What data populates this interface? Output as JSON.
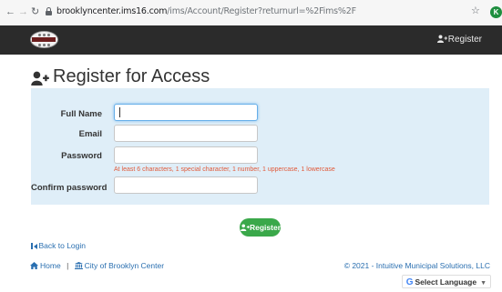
{
  "browser": {
    "url_host": "brooklyncenter.ims16.com",
    "url_path": "/ims/Account/Register?returnurl=%2Fims%2F",
    "avatar_initial": "K"
  },
  "navbar": {
    "logo_text": "CENTER",
    "register_label": "Register"
  },
  "page": {
    "title": "Register for Access"
  },
  "form": {
    "full_name_label": "Full Name",
    "full_name_value": "",
    "email_label": "Email",
    "email_value": "",
    "password_label": "Password",
    "password_value": "",
    "password_hint": "At least 6 characters, 1 special character, 1 number, 1 uppercase, 1 lowercase",
    "confirm_label": "Confirm password",
    "confirm_value": "",
    "submit_label": "Register"
  },
  "links": {
    "back_to_login": "Back to Login",
    "home": "Home",
    "city": "City of Brooklyn Center",
    "copyright": "© 2021 - Intuitive Municipal Solutions, LLC"
  },
  "translate": {
    "label": "Select Language"
  },
  "colors": {
    "navbar": "#2b2b2b",
    "panel": "#dfeef8",
    "primary_button": "#3aa84a",
    "link": "#2a6fb0",
    "hint": "#e05a3a"
  }
}
